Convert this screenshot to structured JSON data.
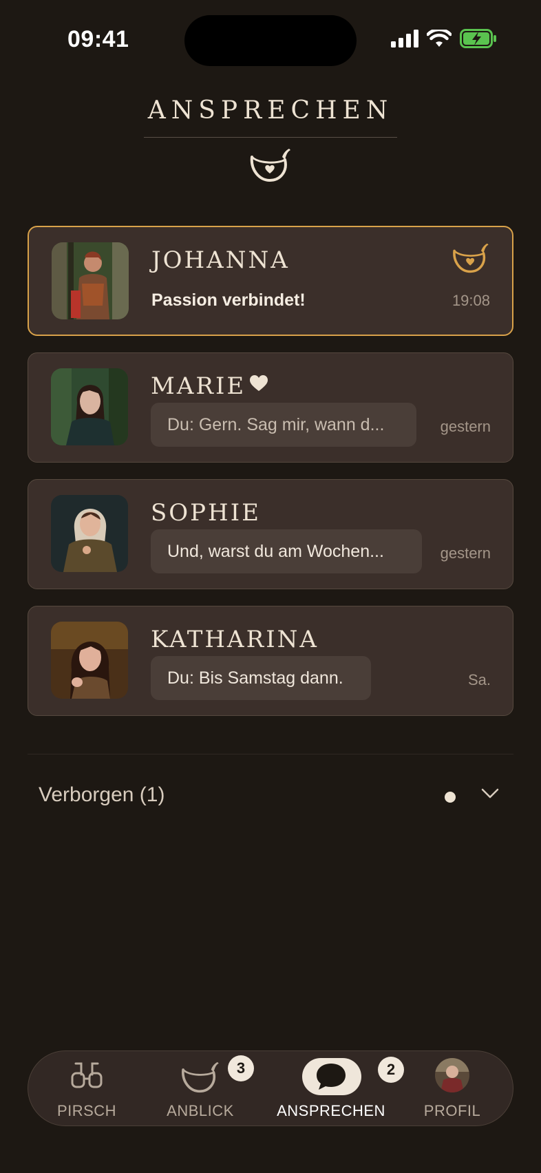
{
  "status": {
    "time": "09:41"
  },
  "header": {
    "title": "ANSPRECHEN"
  },
  "chats": [
    {
      "name": "JOHANNA",
      "message": "Passion verbindet!",
      "time": "19:08",
      "active": true
    },
    {
      "name": "MARIE",
      "message": "Du: Gern. Sag mir, wann d...",
      "time": "gestern",
      "favorite": true
    },
    {
      "name": "SOPHIE",
      "message": "Und, warst du am Wochen...",
      "time": "gestern"
    },
    {
      "name": "KATHARINA",
      "message": "Du: Bis Samstag dann.",
      "time": "Sa."
    }
  ],
  "hidden": {
    "label": "Verborgen (1)"
  },
  "tabs": [
    {
      "label": "PIRSCH",
      "icon": "binoculars-icon"
    },
    {
      "label": "ANBLICK",
      "icon": "horn-icon",
      "badge": "3"
    },
    {
      "label": "ANSPRECHEN",
      "icon": "chat-icon",
      "badge": "2",
      "active": true
    },
    {
      "label": "PROFIL",
      "icon": "avatar"
    }
  ],
  "colors": {
    "background": "#1d1813",
    "card": "#3b2f2a",
    "accent": "#d9a24a",
    "text": "#eee3d3"
  }
}
